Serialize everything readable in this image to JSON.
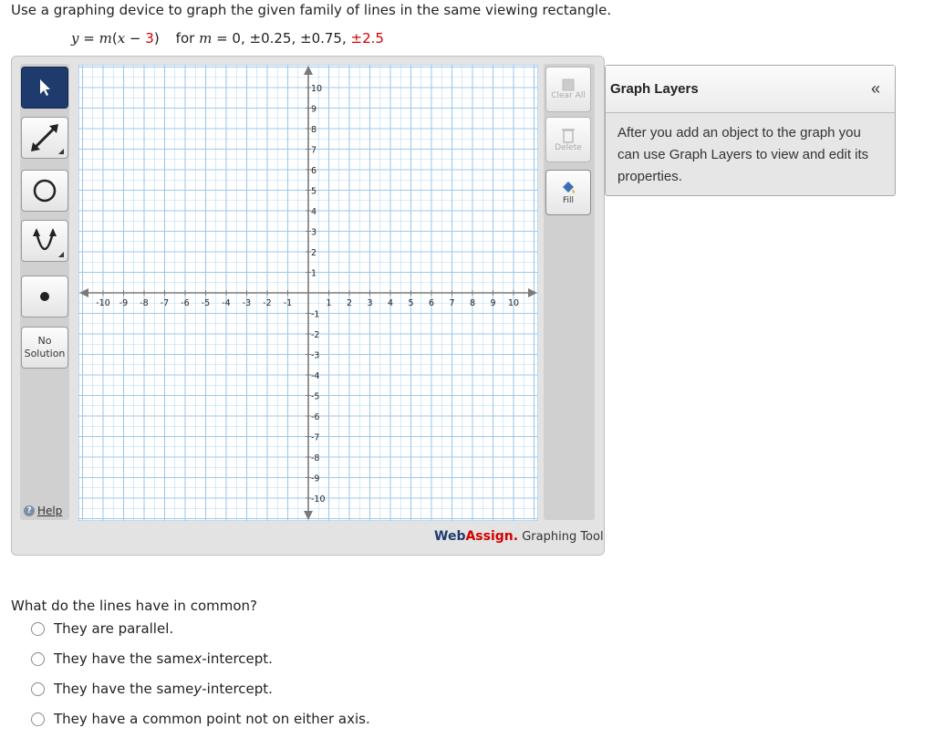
{
  "instructions": "Use a graphing device to graph the given family of lines in the same viewing rectangle.",
  "equation": {
    "lhs": "y",
    "eq1": " = ",
    "m": "m",
    "open": "(",
    "x": "x",
    "minus": " − ",
    "three": "3",
    "close": ")",
    "for_text": "for ",
    "m2": "m",
    "eq2": " = 0, ±0.25, ±0.75, ",
    "last": "±2.5"
  },
  "toolbar": {
    "no_solution_line1": "No",
    "no_solution_line2": "Solution",
    "help_label": "Help"
  },
  "graph": {
    "x_ticks": [
      -10,
      -9,
      -8,
      -7,
      -6,
      -5,
      -4,
      -3,
      -2,
      -1,
      1,
      2,
      3,
      4,
      5,
      6,
      7,
      8,
      9,
      10
    ],
    "y_ticks": [
      10,
      9,
      8,
      7,
      6,
      5,
      4,
      3,
      2,
      1,
      -1,
      -2,
      -3,
      -4,
      -5,
      -6,
      -7,
      -8,
      -9,
      -10
    ],
    "grid_color": "#9ec9ec",
    "axis_color": "#7a7a7a"
  },
  "rightbar": {
    "clear_all": "Clear All",
    "delete": "Delete",
    "fill": "Fill"
  },
  "brand": {
    "web": "Web",
    "assign": "Assign.",
    "tool": " Graphing Tool"
  },
  "layers": {
    "title": "Graph Layers",
    "collapse": "«",
    "body": "After you add an object to the graph you can use Graph Layers to view and edit its properties."
  },
  "question": {
    "prompt": "What do the lines have in common?",
    "options": [
      {
        "pre": "They are parallel.",
        "ital": "",
        "post": ""
      },
      {
        "pre": "They have the same ",
        "ital": "x",
        "post": "-intercept."
      },
      {
        "pre": "They have the same ",
        "ital": "y",
        "post": "-intercept."
      },
      {
        "pre": "They have a common point not on either axis.",
        "ital": "",
        "post": ""
      }
    ]
  }
}
